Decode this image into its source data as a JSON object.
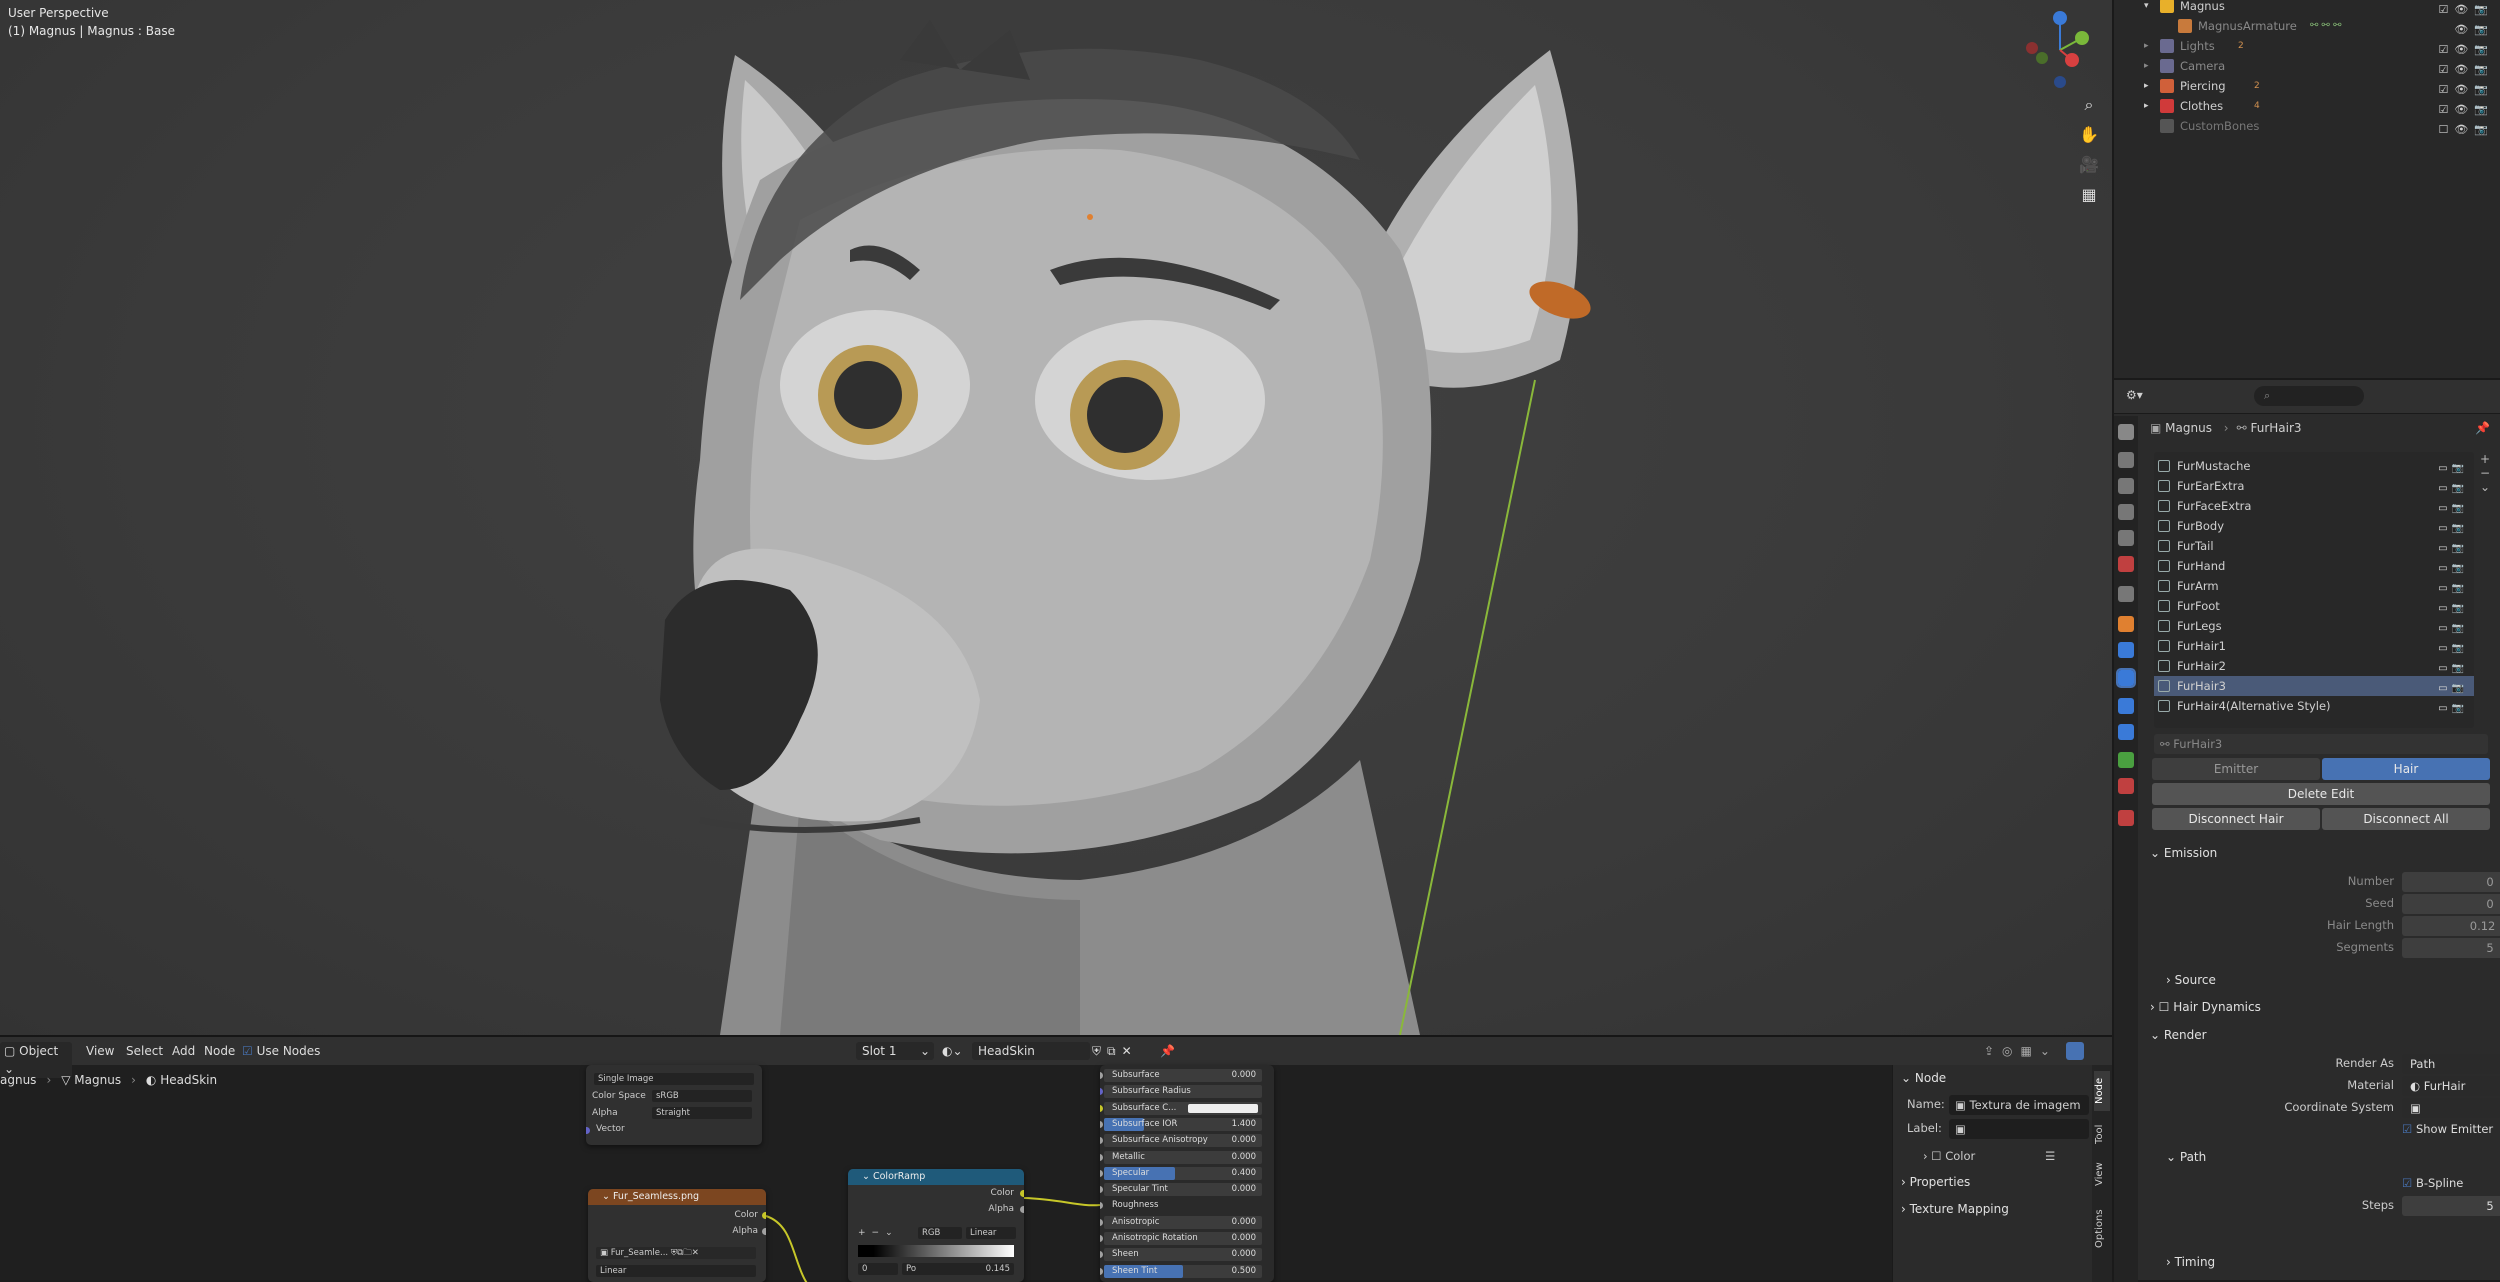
{
  "viewport": {
    "mode": "User Perspective",
    "object_info": "(1) Magnus | Magnus : Base",
    "gizmo_axes": [
      "X",
      "Y",
      "Z"
    ],
    "tools": [
      "zoom-icon",
      "hand-icon",
      "camera-icon",
      "grid-icon"
    ]
  },
  "outliner": {
    "rows": [
      {
        "name": "Magnus",
        "color": "#e8b02a",
        "dim": false
      },
      {
        "name": "MagnusArmature",
        "color": "#c87a3c",
        "dim": true
      },
      {
        "name": "Lights",
        "color": "#8a8ab0",
        "dim": true,
        "count": "2"
      },
      {
        "name": "Camera",
        "color": "#8a8ab0",
        "dim": true
      },
      {
        "name": "Piercing",
        "color": "#d0603a",
        "dim": false,
        "count": "2"
      },
      {
        "name": "Clothes",
        "color": "#d03a3a",
        "dim": false,
        "count": "4"
      },
      {
        "name": "CustomBones",
        "color": "#666",
        "dim": true
      }
    ]
  },
  "props": {
    "breadcrumb": {
      "object": "Magnus",
      "system": "FurHair3"
    },
    "particle_list": [
      "FurMustache",
      "FurEarExtra",
      "FurFaceExtra",
      "FurBody",
      "FurTail",
      "FurHand",
      "FurArm",
      "FurFoot",
      "FurLegs",
      "FurHair1",
      "FurHair2",
      "FurHair3",
      "FurHair4(Alternative Style)"
    ],
    "selected": "FurHair3",
    "settings_name": "FurHair3",
    "type_tabs": [
      "Emitter",
      "Hair"
    ],
    "delete_edit": "Delete Edit",
    "disconnect_hair": "Disconnect Hair",
    "disconnect_all": "Disconnect All",
    "emission": {
      "title": "Emission",
      "number_label": "Number",
      "number": "0",
      "seed_label": "Seed",
      "seed": "0",
      "hair_length_label": "Hair Length",
      "hair_length": "0.12 m",
      "segments_label": "Segments",
      "segments": "5"
    },
    "source": "Source",
    "hair_dynamics": "Hair Dynamics",
    "render": {
      "title": "Render",
      "render_as_label": "Render As",
      "render_as": "Path",
      "material_label": "Material",
      "material": "FurHair",
      "coord_label": "Coordinate System",
      "show_emitter": "Show Emitter"
    },
    "path": {
      "title": "Path",
      "bspline": "B-Spline",
      "steps_label": "Steps",
      "steps": "5"
    },
    "timing": "Timing"
  },
  "node_editor": {
    "header": {
      "mode": "Object",
      "menus": [
        "View",
        "Select",
        "Add",
        "Node"
      ],
      "use_nodes": "Use Nodes",
      "slot": "Slot 1",
      "material": "HeadSkin"
    },
    "breadcrumb": [
      "agnus",
      "Magnus",
      "HeadSkin"
    ],
    "image_node_top": {
      "rows": [
        "Single Image"
      ],
      "color_space_label": "Color Space",
      "color_space": "sRGB",
      "alpha_label": "Alpha",
      "alpha": "Straight",
      "vector": "Vector"
    },
    "image_node": {
      "title": "Fur_Seamless.png",
      "out_color": "Color",
      "out_alpha": "Alpha",
      "image": "Fur_Seamle...",
      "interp": "Linear"
    },
    "colorramp": {
      "title": "ColorRamp",
      "out_color": "Color",
      "out_alpha": "Alpha",
      "mode": "RGB",
      "interp": "Linear",
      "pos_label": "Po",
      "pos_value": "0.145",
      "index": "0"
    },
    "bsdf": [
      {
        "label": "Subsurface",
        "value": "0.000"
      },
      {
        "label": "Subsurface Radius",
        "value": ""
      },
      {
        "label": "Subsurface C...",
        "value": ""
      },
      {
        "label": "Subsurface IOR",
        "value": "1.400"
      },
      {
        "label": "Subsurface Anisotropy",
        "value": "0.000"
      },
      {
        "label": "Metallic",
        "value": "0.000"
      },
      {
        "label": "Specular",
        "value": "0.400"
      },
      {
        "label": "Specular Tint",
        "value": "0.000"
      },
      {
        "label": "Roughness",
        "value": ""
      },
      {
        "label": "Anisotropic",
        "value": "0.000"
      },
      {
        "label": "Anisotropic Rotation",
        "value": "0.000"
      },
      {
        "label": "Sheen",
        "value": "0.000"
      },
      {
        "label": "Sheen Tint",
        "value": "0.500"
      }
    ],
    "side": {
      "title": "Node",
      "name_label": "Name:",
      "name": "Textura de imagem",
      "label_label": "Label:",
      "color": "Color",
      "properties": "Properties",
      "texture_mapping": "Texture Mapping"
    },
    "side_tabs": [
      "Node",
      "Tool",
      "View",
      "Options"
    ]
  }
}
